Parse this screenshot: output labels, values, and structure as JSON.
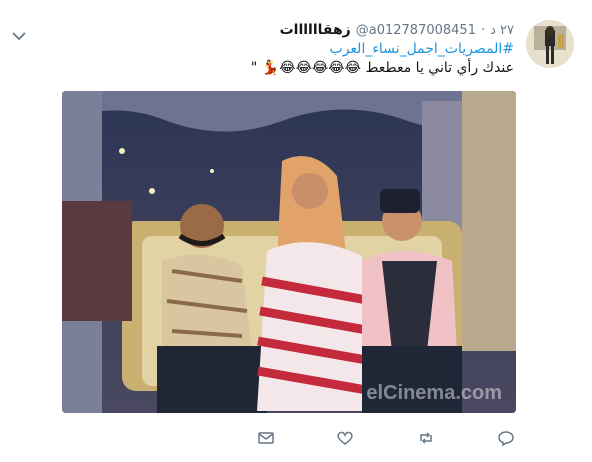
{
  "tweet": {
    "display_name": "زهقاااااات",
    "handle": "@a012787008451",
    "separator": "·",
    "time": "٢٧ د",
    "hashtag": "#المصريات_اجمل_نساء_العرب",
    "body": "عندك رأي تاني يا معطعط 😂😂😂😂😂💃 \"",
    "media": {
      "watermark": "elCinema.com"
    }
  },
  "actions": {
    "icons": [
      "mail-icon",
      "heart-icon",
      "retweet-icon",
      "reply-icon"
    ]
  },
  "colors": {
    "link": "#1b95e0",
    "secondary_text": "#657786",
    "icon": "#657786"
  }
}
